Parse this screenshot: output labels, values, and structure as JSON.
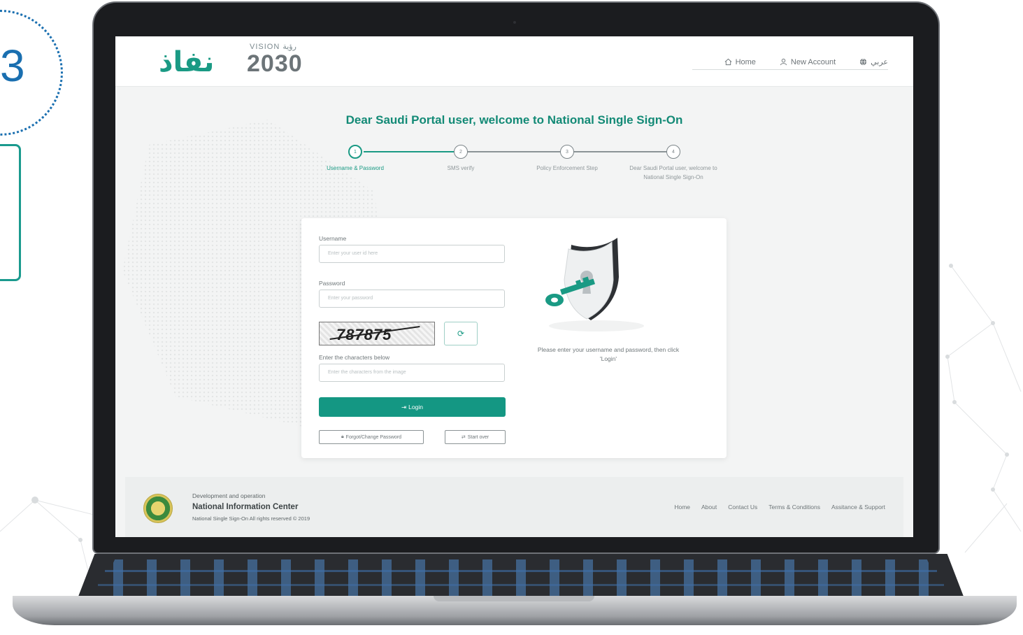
{
  "badge": {
    "number": "3"
  },
  "colors": {
    "brand": "#149783",
    "brand_text": "#138a76",
    "badge_blue": "#1a6fb0"
  },
  "header": {
    "logo_text": "نفاذ",
    "vision_label": "VISION رؤية",
    "vision_year": "2030",
    "nav": [
      {
        "icon": "home-icon",
        "label": "Home"
      },
      {
        "icon": "user-icon",
        "label": "New Account"
      },
      {
        "icon": "globe-icon",
        "label": "عربي"
      }
    ]
  },
  "welcome_title": "Dear Saudi Portal user, welcome to National Single Sign-On",
  "steps": [
    {
      "number": "1",
      "label": "Username & Password",
      "active": true
    },
    {
      "number": "2",
      "label": "SMS verify",
      "active": false
    },
    {
      "number": "3",
      "label": "Policy Enforcement Step",
      "active": false
    },
    {
      "number": "4",
      "label": "Dear Saudi Portal user, welcome to National Single Sign-On",
      "active": false
    }
  ],
  "form": {
    "username_label": "Username",
    "username_placeholder": "Enter your user id here",
    "password_label": "Password",
    "password_placeholder": "Enter your password",
    "captcha_value": "787875",
    "captcha_label": "Enter the characters below",
    "captcha_placeholder": "Enter the characters from the image",
    "login_label": "Login",
    "forgot_label": "Forgot/Change Password",
    "start_over_label": "Start over"
  },
  "hint_text": "Please enter your username and password, then click 'Login'",
  "footer": {
    "small": "Development and operation",
    "title": "National Information Center",
    "copyright": "National Single Sign-On All rights reserved © 2019",
    "links": [
      "Home",
      "About",
      "Contact Us",
      "Terms & Conditions",
      "Assitance & Support"
    ]
  }
}
